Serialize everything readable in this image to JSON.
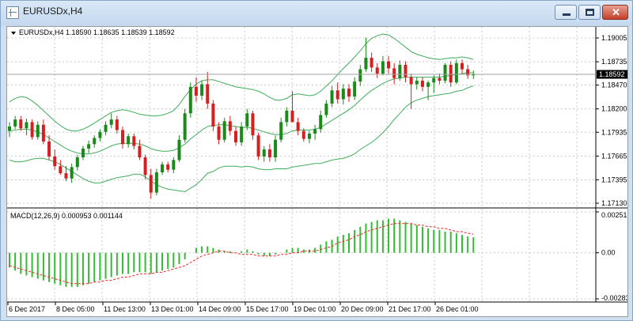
{
  "window": {
    "title": "EURUSDx,H4",
    "minimize_icon": "minimize-icon",
    "maximize_icon": "maximize-icon",
    "close_icon": "close-icon"
  },
  "colors": {
    "bull": "#1a8a1a",
    "bear": "#d42020",
    "bands": "#3fae5a",
    "macd_hist": "#33bb33",
    "macd_signal": "#ee2222",
    "grid": "#c8c8c8"
  },
  "price_panel": {
    "header": "EURUSDx,H4  1.18590 1.18635 1.18539 1.18592",
    "current_price_label": "1.18592"
  },
  "macd_panel": {
    "header": "MACD(12,26,9) 0.000953 0.001144"
  },
  "chart_data": [
    {
      "type": "candlestick",
      "title": "EURUSDx,H4",
      "ohlc_header": {
        "open": 1.1859,
        "high": 1.18635,
        "low": 1.18539,
        "close": 1.18592
      },
      "current_price": 1.18592,
      "y_ticks": [
        "1.19005",
        "1.18735",
        "1.18470",
        "1.18200",
        "1.17935",
        "1.17665",
        "1.17395",
        "1.17130"
      ],
      "ylim": [
        1.1713,
        1.19005
      ],
      "x_ticks": [
        "6 Dec 2017",
        "8 Dec 05:00",
        "11 Dec 13:00",
        "13 Dec 01:00",
        "14 Dec 09:00",
        "15 Dec 17:00",
        "19 Dec 01:00",
        "20 Dec 09:00",
        "21 Dec 17:00",
        "26 Dec 01:00"
      ],
      "grid": true,
      "candles": [
        [
          1.1795,
          1.1805,
          1.1788,
          1.18
        ],
        [
          1.18,
          1.1812,
          1.1797,
          1.1808
        ],
        [
          1.1808,
          1.1812,
          1.1795,
          1.1798
        ],
        [
          1.1798,
          1.1809,
          1.179,
          1.1805
        ],
        [
          1.1805,
          1.1808,
          1.1785,
          1.1788
        ],
        [
          1.1788,
          1.1806,
          1.1785,
          1.1802
        ],
        [
          1.1802,
          1.1808,
          1.178,
          1.1783
        ],
        [
          1.1783,
          1.179,
          1.1762,
          1.1766
        ],
        [
          1.1766,
          1.1774,
          1.1751,
          1.1755
        ],
        [
          1.1755,
          1.1762,
          1.1745,
          1.1747
        ],
        [
          1.1747,
          1.1755,
          1.1738,
          1.1741
        ],
        [
          1.1741,
          1.1758,
          1.1736,
          1.1754
        ],
        [
          1.1754,
          1.1768,
          1.175,
          1.1765
        ],
        [
          1.1765,
          1.1778,
          1.1762,
          1.1775
        ],
        [
          1.1775,
          1.1784,
          1.177,
          1.178
        ],
        [
          1.178,
          1.179,
          1.1776,
          1.1787
        ],
        [
          1.1787,
          1.1797,
          1.1783,
          1.1794
        ],
        [
          1.1794,
          1.1806,
          1.179,
          1.1802
        ],
        [
          1.1802,
          1.1815,
          1.1798,
          1.1808
        ],
        [
          1.1808,
          1.1812,
          1.1792,
          1.1796
        ],
        [
          1.1796,
          1.18,
          1.1775,
          1.178
        ],
        [
          1.178,
          1.1792,
          1.1776,
          1.1789
        ],
        [
          1.1789,
          1.1792,
          1.1774,
          1.1778
        ],
        [
          1.1778,
          1.1785,
          1.1762,
          1.1765
        ],
        [
          1.1765,
          1.1768,
          1.174,
          1.1745
        ],
        [
          1.1745,
          1.1752,
          1.1718,
          1.1725
        ],
        [
          1.1725,
          1.1752,
          1.1722,
          1.1748
        ],
        [
          1.1748,
          1.176,
          1.1745,
          1.1757
        ],
        [
          1.1757,
          1.176,
          1.1748,
          1.1751
        ],
        [
          1.1751,
          1.1765,
          1.1747,
          1.1762
        ],
        [
          1.1762,
          1.179,
          1.176,
          1.1785
        ],
        [
          1.1785,
          1.182,
          1.1782,
          1.1815
        ],
        [
          1.1815,
          1.185,
          1.181,
          1.1845
        ],
        [
          1.1845,
          1.1856,
          1.1828,
          1.1835
        ],
        [
          1.1835,
          1.1852,
          1.183,
          1.1848
        ],
        [
          1.1848,
          1.1862,
          1.182,
          1.1826
        ],
        [
          1.1826,
          1.183,
          1.1795,
          1.18
        ],
        [
          1.18,
          1.1805,
          1.178,
          1.1785
        ],
        [
          1.1785,
          1.181,
          1.1782,
          1.1806
        ],
        [
          1.1806,
          1.1812,
          1.179,
          1.1795
        ],
        [
          1.1795,
          1.18,
          1.1778,
          1.1782
        ],
        [
          1.1782,
          1.1805,
          1.1778,
          1.18
        ],
        [
          1.18,
          1.182,
          1.1796,
          1.1815
        ],
        [
          1.1815,
          1.1818,
          1.1785,
          1.179
        ],
        [
          1.179,
          1.1793,
          1.1762,
          1.1766
        ],
        [
          1.1766,
          1.1778,
          1.176,
          1.1774
        ],
        [
          1.1774,
          1.178,
          1.176,
          1.1765
        ],
        [
          1.1765,
          1.179,
          1.176,
          1.1785
        ],
        [
          1.1785,
          1.181,
          1.1782,
          1.1805
        ],
        [
          1.1805,
          1.1822,
          1.18,
          1.1818
        ],
        [
          1.1818,
          1.184,
          1.181,
          1.1805
        ],
        [
          1.1805,
          1.181,
          1.179,
          1.1795
        ],
        [
          1.1795,
          1.1798,
          1.1783,
          1.1786
        ],
        [
          1.1786,
          1.1795,
          1.1781,
          1.1792
        ],
        [
          1.1792,
          1.1802,
          1.1785,
          1.1797
        ],
        [
          1.1797,
          1.1818,
          1.1793,
          1.1813
        ],
        [
          1.1813,
          1.183,
          1.181,
          1.1826
        ],
        [
          1.1826,
          1.1846,
          1.1822,
          1.1841
        ],
        [
          1.1841,
          1.185,
          1.1826,
          1.1831
        ],
        [
          1.1831,
          1.1848,
          1.1825,
          1.1843
        ],
        [
          1.1843,
          1.1848,
          1.1828,
          1.1834
        ],
        [
          1.1834,
          1.1856,
          1.183,
          1.1851
        ],
        [
          1.1851,
          1.187,
          1.1846,
          1.1865
        ],
        [
          1.1865,
          1.1901,
          1.1862,
          1.1878
        ],
        [
          1.1878,
          1.1884,
          1.1862,
          1.1867
        ],
        [
          1.1867,
          1.1872,
          1.1855,
          1.186
        ],
        [
          1.186,
          1.188,
          1.1858,
          1.1874
        ],
        [
          1.1874,
          1.188,
          1.186,
          1.1866
        ],
        [
          1.1866,
          1.1872,
          1.1848,
          1.1855
        ],
        [
          1.1855,
          1.1875,
          1.1852,
          1.187
        ],
        [
          1.187,
          1.1874,
          1.185,
          1.1856
        ],
        [
          1.1856,
          1.186,
          1.182,
          1.1848
        ],
        [
          1.1848,
          1.1856,
          1.1842,
          1.1852
        ],
        [
          1.1852,
          1.1856,
          1.184,
          1.1845
        ],
        [
          1.1845,
          1.1852,
          1.183,
          1.185
        ],
        [
          1.185,
          1.1858,
          1.1838,
          1.1855
        ],
        [
          1.1855,
          1.186,
          1.1848,
          1.1852
        ],
        [
          1.1852,
          1.1872,
          1.1849,
          1.187
        ],
        [
          1.187,
          1.1874,
          1.1845,
          1.185
        ],
        [
          1.185,
          1.1876,
          1.1848,
          1.1872
        ],
        [
          1.1872,
          1.1876,
          1.186,
          1.1865
        ],
        [
          1.1865,
          1.187,
          1.1854,
          1.1858
        ],
        [
          1.1858,
          1.18635,
          1.18539,
          1.18592
        ]
      ],
      "bollinger_upper": [
        1.1828,
        1.1832,
        1.1834,
        1.1833,
        1.1829,
        1.1824,
        1.1818,
        1.1812,
        1.1806,
        1.1801,
        1.1797,
        1.1795,
        1.1795,
        1.1797,
        1.18,
        1.1804,
        1.1808,
        1.1812,
        1.1816,
        1.1818,
        1.1819,
        1.1818,
        1.1816,
        1.1814,
        1.1813,
        1.1812,
        1.1812,
        1.1813,
        1.1815,
        1.1818,
        1.1825,
        1.1834,
        1.1842,
        1.1848,
        1.1852,
        1.1853,
        1.1853,
        1.1851,
        1.1849,
        1.1847,
        1.1845,
        1.1844,
        1.1843,
        1.1842,
        1.184,
        1.1837,
        1.1833,
        1.183,
        1.183,
        1.1832,
        1.1836,
        1.1837,
        1.1836,
        1.1835,
        1.1836,
        1.184,
        1.1846,
        1.1852,
        1.1859,
        1.1866,
        1.1872,
        1.1879,
        1.1886,
        1.1894,
        1.19,
        1.1903,
        1.1905,
        1.1904,
        1.19,
        1.1895,
        1.189,
        1.1885,
        1.1882,
        1.188,
        1.1878,
        1.1877,
        1.1876,
        1.1877,
        1.1878,
        1.1878,
        1.1879,
        1.1878,
        1.1876
      ],
      "bollinger_middle": [
        1.1795,
        1.1796,
        1.1797,
        1.1797,
        1.1796,
        1.1794,
        1.1791,
        1.1787,
        1.1783,
        1.1779,
        1.1775,
        1.1772,
        1.177,
        1.1769,
        1.1769,
        1.177,
        1.1772,
        1.1775,
        1.1778,
        1.178,
        1.1781,
        1.1781,
        1.1781,
        1.178,
        1.1778,
        1.1775,
        1.1773,
        1.1772,
        1.1772,
        1.1773,
        1.1776,
        1.178,
        1.1786,
        1.1791,
        1.1796,
        1.18,
        1.1801,
        1.1802,
        1.1802,
        1.1801,
        1.18,
        1.1799,
        1.1799,
        1.1798,
        1.1796,
        1.1794,
        1.1792,
        1.1791,
        1.1791,
        1.1792,
        1.1795,
        1.1796,
        1.1796,
        1.1796,
        1.1797,
        1.1799,
        1.1803,
        1.1807,
        1.1811,
        1.1815,
        1.1819,
        1.1824,
        1.183,
        1.1836,
        1.1841,
        1.1845,
        1.1849,
        1.1852,
        1.1854,
        1.1855,
        1.1856,
        1.1856,
        1.1856,
        1.1856,
        1.1856,
        1.1856,
        1.1856,
        1.1857,
        1.1858,
        1.1859,
        1.186,
        1.1861,
        1.1861
      ],
      "bollinger_lower": [
        1.1762,
        1.176,
        1.176,
        1.1761,
        1.1763,
        1.1764,
        1.1764,
        1.1762,
        1.176,
        1.1757,
        1.1753,
        1.1749,
        1.1745,
        1.1741,
        1.1738,
        1.1736,
        1.1736,
        1.1738,
        1.174,
        1.1742,
        1.1743,
        1.1744,
        1.1746,
        1.1746,
        1.1743,
        1.1738,
        1.1734,
        1.1731,
        1.1729,
        1.1728,
        1.1727,
        1.1726,
        1.173,
        1.1734,
        1.174,
        1.1747,
        1.1749,
        1.1753,
        1.1755,
        1.1755,
        1.1755,
        1.1754,
        1.1755,
        1.1754,
        1.1752,
        1.1751,
        1.1751,
        1.1752,
        1.1752,
        1.1752,
        1.1754,
        1.1755,
        1.1756,
        1.1757,
        1.1758,
        1.1758,
        1.176,
        1.1762,
        1.1763,
        1.1764,
        1.1766,
        1.1769,
        1.1774,
        1.1778,
        1.1782,
        1.1787,
        1.1793,
        1.18,
        1.1808,
        1.1815,
        1.1822,
        1.1827,
        1.183,
        1.1832,
        1.1834,
        1.1835,
        1.1836,
        1.1837,
        1.1838,
        1.184,
        1.1841,
        1.1844,
        1.1846
      ]
    },
    {
      "type": "bar",
      "title": "MACD(12,26,9)",
      "macd_value": 0.000953,
      "signal_value": 0.001144,
      "y_ticks": [
        "0.002517",
        "0.00",
        "-0.002838"
      ],
      "ylim": [
        -0.002838,
        0.002517
      ],
      "histogram": [
        -0.0009,
        -0.0011,
        -0.0013,
        -0.0014,
        -0.0015,
        -0.0016,
        -0.0017,
        -0.0018,
        -0.0019,
        -0.002,
        -0.0021,
        -0.0021,
        -0.0021,
        -0.002,
        -0.0019,
        -0.0018,
        -0.0017,
        -0.0016,
        -0.0015,
        -0.0014,
        -0.0013,
        -0.0013,
        -0.0012,
        -0.0012,
        -0.0012,
        -0.0013,
        -0.0012,
        -0.0011,
        -0.001,
        -0.0009,
        -0.0007,
        -0.0004,
        0.0,
        0.0003,
        0.0004,
        0.0004,
        0.0003,
        0.0002,
        0.0001,
        0.0001,
        0.0,
        0.0001,
        0.0002,
        0.0001,
        -0.0001,
        -0.0002,
        -0.0002,
        -0.0001,
        0.0,
        0.0002,
        0.0003,
        0.0003,
        0.0002,
        0.0002,
        0.0003,
        0.0005,
        0.0007,
        0.0008,
        0.001,
        0.0011,
        0.0012,
        0.0014,
        0.0016,
        0.0018,
        0.0019,
        0.002,
        0.002,
        0.0021,
        0.0021,
        0.002,
        0.0019,
        0.0018,
        0.0017,
        0.0016,
        0.0015,
        0.0014,
        0.0014,
        0.0013,
        0.0013,
        0.0012,
        0.0011,
        0.001,
        0.000953
      ],
      "signal": [
        -0.0008,
        -0.0009,
        -0.001,
        -0.0011,
        -0.0012,
        -0.0013,
        -0.0014,
        -0.0015,
        -0.0016,
        -0.0017,
        -0.0018,
        -0.0019,
        -0.0019,
        -0.0019,
        -0.0019,
        -0.0018,
        -0.0018,
        -0.0017,
        -0.0017,
        -0.0016,
        -0.0015,
        -0.0015,
        -0.0014,
        -0.0013,
        -0.0013,
        -0.0013,
        -0.0012,
        -0.0012,
        -0.0011,
        -0.001,
        -0.0009,
        -0.0008,
        -0.0006,
        -0.0004,
        -0.0002,
        -0.0001,
        0.0,
        0.0001,
        0.0001,
        0.0,
        0.0,
        -0.0001,
        -0.0001,
        -0.0001,
        -0.0002,
        -0.0002,
        -0.0002,
        -0.0002,
        -0.0001,
        -0.0001,
        0.0,
        0.0,
        0.0001,
        0.0001,
        0.0001,
        0.0002,
        0.0003,
        0.0004,
        0.0006,
        0.0007,
        0.0008,
        0.001,
        0.0011,
        0.0013,
        0.0014,
        0.0015,
        0.0016,
        0.0017,
        0.0018,
        0.0018,
        0.0018,
        0.0018,
        0.0017,
        0.0017,
        0.0016,
        0.0016,
        0.0015,
        0.0015,
        0.0014,
        0.0013,
        0.0013,
        0.0012,
        0.001144
      ]
    }
  ]
}
